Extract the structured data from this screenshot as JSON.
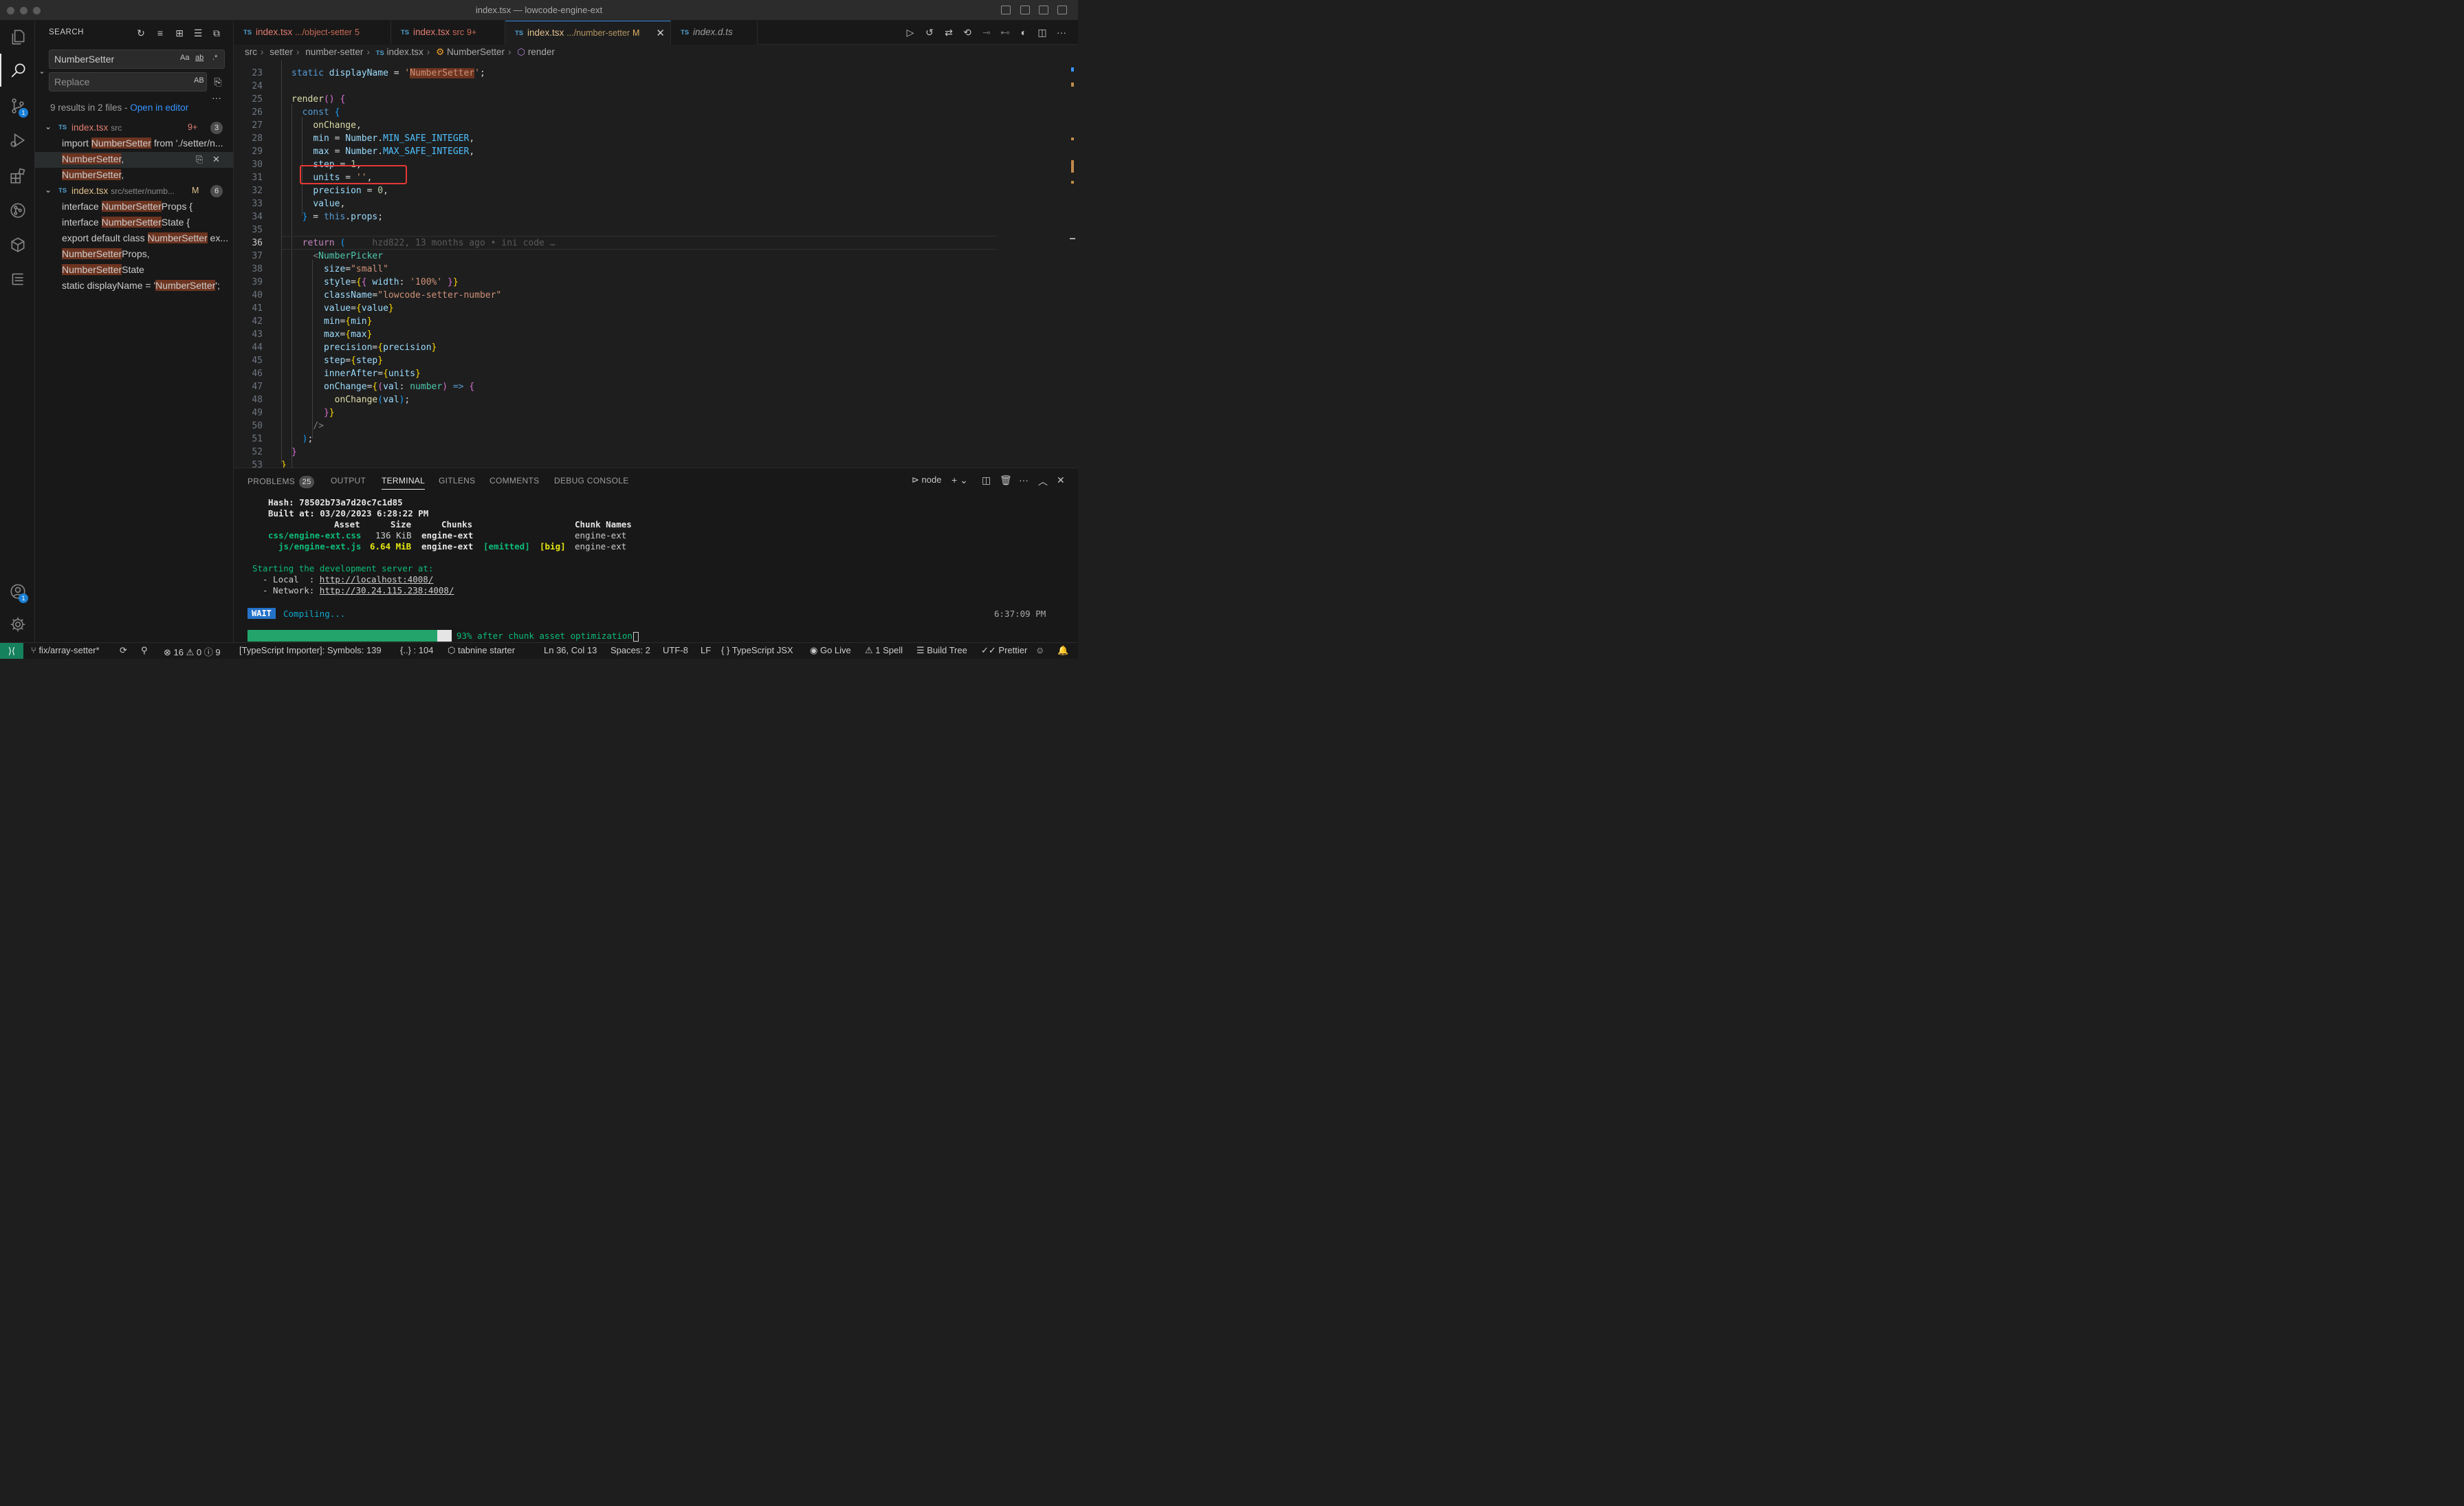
{
  "window": {
    "title": "index.tsx — lowcode-engine-ext"
  },
  "activity_bar": {
    "scm_badge": "1",
    "accounts_badge": "1"
  },
  "sidebar": {
    "title": "SEARCH",
    "search": {
      "value": "NumberSetter",
      "opt_case": "Aa",
      "opt_word": "ab",
      "opt_regex": ".*"
    },
    "replace": {
      "placeholder": "Replace",
      "opt_preserve": "AB"
    },
    "more": "···",
    "summary": {
      "text": "9 results in 2 files - ",
      "link": "Open in editor"
    },
    "files": [
      {
        "lang": "TS",
        "name": "index.tsx",
        "path": "src",
        "mark": "9+",
        "count": "3",
        "matches": [
          {
            "pre": "import ",
            "hl": "NumberSetter",
            "post": " from './setter/n..."
          },
          {
            "pre": "",
            "hl": "NumberSetter",
            "post": ","
          },
          {
            "pre": "",
            "hl": "NumberSetter",
            "post": ","
          }
        ]
      },
      {
        "lang": "TS",
        "name": "index.tsx",
        "path": "src/setter/numb...",
        "mark": "M",
        "count": "6",
        "matches": [
          {
            "pre": "interface ",
            "hl": "NumberSetter",
            "post": "Props {"
          },
          {
            "pre": "interface ",
            "hl": "NumberSetter",
            "post": "State {"
          },
          {
            "pre": "export default class ",
            "hl": "NumberSetter",
            "post": " ex..."
          },
          {
            "pre": "",
            "hl": "NumberSetter",
            "post": "Props,"
          },
          {
            "pre": "",
            "hl": "NumberSetter",
            "post": "State"
          },
          {
            "pre": "static displayName = '",
            "hl": "NumberSetter",
            "post": "';"
          }
        ]
      }
    ]
  },
  "tabs": [
    {
      "lang": "TS",
      "name": "index.tsx",
      "desc": ".../object-setter",
      "flag": "5"
    },
    {
      "lang": "TS",
      "name": "index.tsx",
      "desc": "src",
      "flag": "9+"
    },
    {
      "lang": "TS",
      "name": "index.tsx",
      "desc": ".../number-setter",
      "flag": "M"
    },
    {
      "lang": "TS",
      "name": "index.d.ts",
      "desc": "",
      "flag": ""
    }
  ],
  "breadcrumb": [
    "src",
    "setter",
    "number-setter",
    "index.tsx",
    "NumberSetter",
    "render"
  ],
  "editor": {
    "line_numbers": [
      "23",
      "24",
      "25",
      "26",
      "27",
      "28",
      "29",
      "30",
      "31",
      "32",
      "33",
      "34",
      "35",
      "36",
      "37",
      "38",
      "39",
      "40",
      "41",
      "42",
      "43",
      "44",
      "45",
      "46",
      "47",
      "48",
      "49",
      "50",
      "51",
      "52",
      "53"
    ],
    "current_line": "36",
    "blame": "hzd822, 13 months ago • ini code …"
  },
  "panel": {
    "tabs": [
      "PROBLEMS",
      "OUTPUT",
      "TERMINAL",
      "GITLENS",
      "COMMENTS",
      "DEBUG CONSOLE"
    ],
    "problems_count": "25",
    "terminal_name": "node",
    "terminal": {
      "hash_label": "Hash:",
      "hash": "78502b73a7d20c7c1d85",
      "built_label": "Built at:",
      "built": "03/20/2023 6:28:22 PM",
      "headers": [
        "Asset",
        "Size",
        "Chunks",
        "Chunk Names"
      ],
      "rows": [
        {
          "asset": "css/engine-ext.css",
          "size": "136 KiB",
          "chunks": "engine-ext",
          "emitted": "",
          "big": "",
          "names": "engine-ext"
        },
        {
          "asset": "js/engine-ext.js",
          "size": "6.64 MiB",
          "chunks": "engine-ext",
          "emitted": "[emitted]",
          "big": "[big]",
          "names": "engine-ext"
        }
      ],
      "starting": "Starting the development server at:",
      "local_label": "- Local  :",
      "local_url": "http://localhost:4008/",
      "network_label": "- Network:",
      "network_url": "http://30.24.115.238:4008/",
      "wait": "WAIT",
      "compiling": "Compiling...",
      "time": "6:37:09 PM",
      "progress_fraction": 0.93,
      "progress_text": "93% after chunk asset optimization"
    }
  },
  "statusbar": {
    "branch": "fix/array-setter*",
    "errors": "16",
    "warnings": "0",
    "infos": "9",
    "ts_importer": "[TypeScript Importer]: Symbols: 139",
    "braces": "{..} : 104",
    "tabnine": "tabnine starter",
    "position": "Ln 36, Col 13",
    "spaces": "Spaces: 2",
    "encoding": "UTF-8",
    "eol": "LF",
    "language": "TypeScript JSX",
    "golive": "Go Live",
    "spell": "1 Spell",
    "buildtree": "Build Tree",
    "prettier": "Prettier"
  },
  "colors": {
    "accent": "#3b8eea",
    "match_highlight": "#6d3420",
    "remote": "#16825d",
    "annotation_box": "#e53935"
  }
}
